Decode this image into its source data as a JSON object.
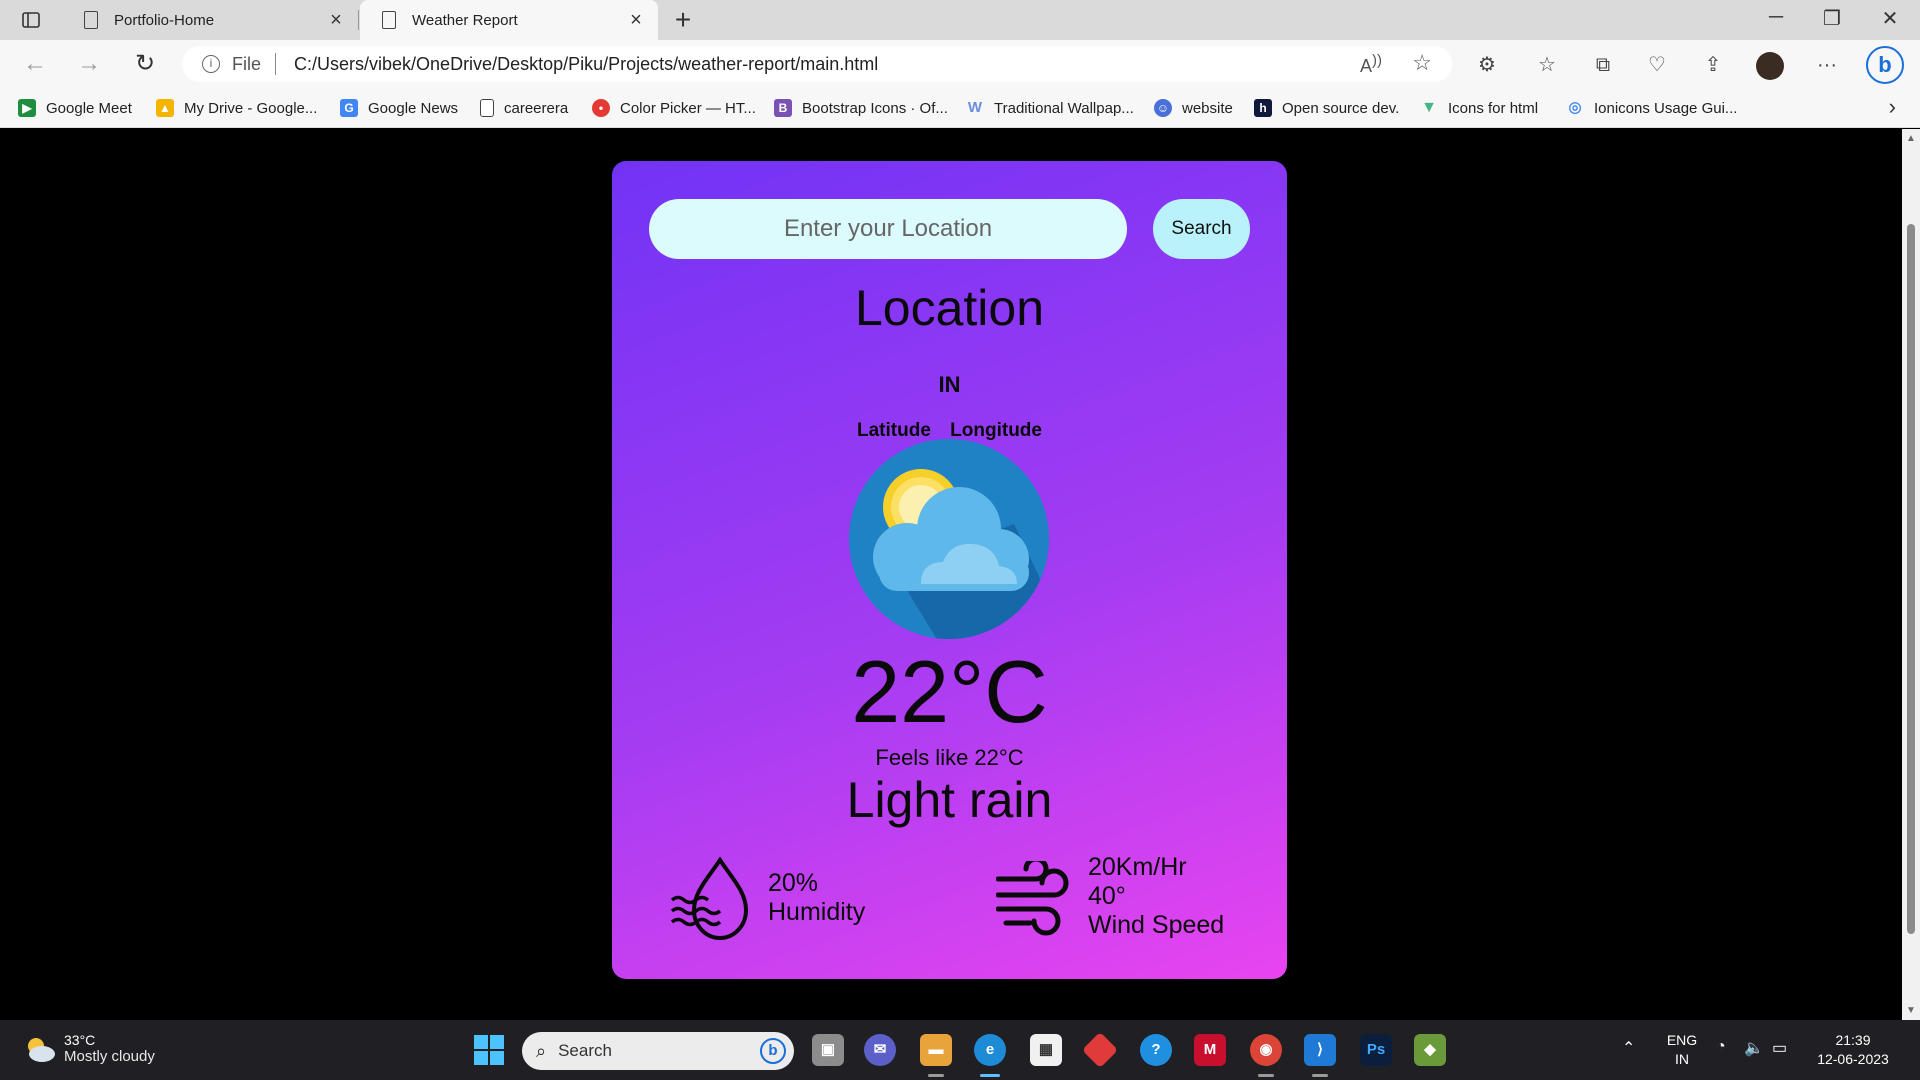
{
  "browser": {
    "tabs": [
      {
        "title": "Portfolio-Home",
        "active": false
      },
      {
        "title": "Weather Report",
        "active": true
      }
    ],
    "address": {
      "scheme_label": "File",
      "url": "C:/Users/vibek/OneDrive/Desktop/Piku/Projects/weather-report/main.html"
    },
    "bookmarks": [
      {
        "label": "Google Meet",
        "icon": "google-meet-icon",
        "color": "#1e8e3e"
      },
      {
        "label": "My Drive - Google...",
        "icon": "google-drive-icon",
        "color": "#f4b400"
      },
      {
        "label": "Google News",
        "icon": "google-news-icon",
        "color": "#4285f4"
      },
      {
        "label": "careerera",
        "icon": "page-icon",
        "color": "#ffffff"
      },
      {
        "label": "Color Picker — HT...",
        "icon": "color-picker-icon",
        "color": "#e53935"
      },
      {
        "label": "Bootstrap Icons · Of...",
        "icon": "bootstrap-icon",
        "color": "#7952b3"
      },
      {
        "label": "Traditional Wallpap...",
        "icon": "w-icon",
        "color": "#6a8fd8"
      },
      {
        "label": "website",
        "icon": "website-icon",
        "color": "#4a6fd8"
      },
      {
        "label": "Open source dev.",
        "icon": "h-icon",
        "color": "#111a3a"
      },
      {
        "label": "Icons for html",
        "icon": "vue-icon",
        "color": "#41b883"
      },
      {
        "label": "Ionicons Usage Gui...",
        "icon": "ionicons-icon",
        "color": "#4d8af0"
      }
    ]
  },
  "app": {
    "search": {
      "placeholder": "Enter your Location",
      "button_label": "Search"
    },
    "location": {
      "name": "Location",
      "country": "IN",
      "latitude_label": "Latitude",
      "longitude_label": "Longitude"
    },
    "weather": {
      "temperature": "22°C",
      "feels_like": "Feels like 22°C",
      "condition": "Light rain",
      "icon": "sun-behind-cloud-icon"
    },
    "humidity": {
      "value": "20%",
      "label": "Humidity"
    },
    "wind": {
      "speed": "20Km/Hr",
      "direction": "40°",
      "label": "Wind Speed"
    }
  },
  "taskbar": {
    "weather": {
      "temp": "33°C",
      "desc": "Mostly cloudy"
    },
    "search_placeholder": "Search",
    "tray": {
      "lang": "ENG",
      "region": "IN",
      "time": "21:39",
      "date": "12-06-2023"
    }
  },
  "colors": {
    "card_gradient_start": "#7233f5",
    "card_gradient_end": "#e844ef",
    "input_bg": "#dcfbfd",
    "button_bg": "#b9f2fa"
  }
}
